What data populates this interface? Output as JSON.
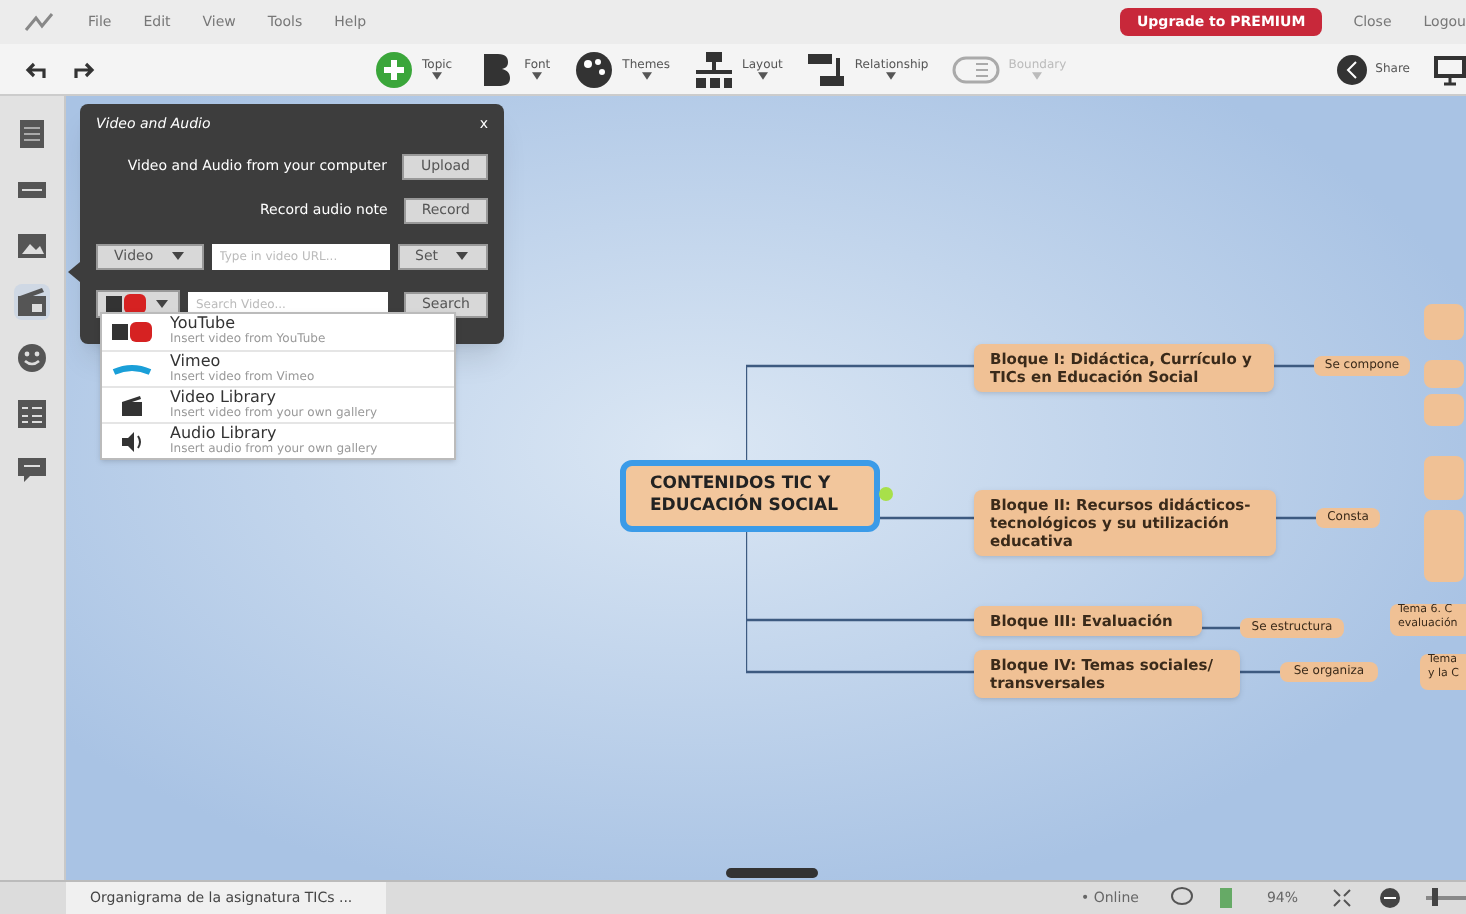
{
  "menu_bar": {
    "items": [
      "File",
      "Edit",
      "View",
      "Tools",
      "Help"
    ],
    "upgrade": "Upgrade to PREMIUM",
    "close": "Close",
    "logout": "Logou"
  },
  "toolbar": {
    "tools": [
      {
        "kind": "topic",
        "label": "Topic",
        "disabled": false
      },
      {
        "kind": "font",
        "label": "Font",
        "disabled": false
      },
      {
        "kind": "themes",
        "label": "Themes",
        "disabled": false
      },
      {
        "kind": "layout",
        "label": "Layout",
        "disabled": false
      },
      {
        "kind": "relationship",
        "label": "Relationship",
        "disabled": false
      },
      {
        "kind": "boundary",
        "label": "Boundary",
        "disabled": true
      }
    ],
    "share": "Share"
  },
  "sidebar": {
    "items": [
      {
        "kind": "note"
      },
      {
        "kind": "link"
      },
      {
        "kind": "image"
      },
      {
        "kind": "video",
        "selected": true
      },
      {
        "kind": "emoji",
        "selected": false
      },
      {
        "kind": "task",
        "selected": false
      },
      {
        "kind": "comment",
        "selected": false
      }
    ]
  },
  "media_panel": {
    "title": "Video and Audio",
    "close": "x",
    "upload_label": "Video and Audio from your computer",
    "upload_button": "Upload",
    "record_label": "Record audio note",
    "record_button": "Record",
    "type_select": "Video",
    "url_placeholder": "Type in video URL...",
    "set_button": "Set",
    "search_placeholder": "Search Video...",
    "search_button": "Search",
    "sources": [
      {
        "kind": "youtube",
        "name": "YouTube",
        "description": "Insert video from YouTube"
      },
      {
        "kind": "vimeo",
        "name": "Vimeo",
        "description": "Insert video from Vimeo"
      },
      {
        "kind": "video",
        "name": "Video Library",
        "description": "Insert video from your own gallery"
      },
      {
        "kind": "audio",
        "name": "Audio Library",
        "description": "Insert audio from your own gallery"
      }
    ]
  },
  "mind_map": {
    "central": "CONTENIDOS TIC Y EDUCACIÓN SOCIAL",
    "branches": [
      {
        "title": "Bloque I: Didáctica, Currículo y TICs en Educación Social",
        "link": "Se compone"
      },
      {
        "title": "Bloque II: Recursos didácticos-tecnológicos y su utilización educativa",
        "link": "Consta"
      },
      {
        "title": "Bloque III: Evaluación",
        "link": "Se estructura",
        "subtopics": [
          [
            "Tema 6. C",
            "evaluación"
          ]
        ]
      },
      {
        "title": "Bloque IV: Temas sociales/ transversales",
        "link": "Se organiza",
        "subtopics": [
          [
            "Tema",
            "y la C"
          ]
        ]
      }
    ]
  },
  "status_bar": {
    "document_tab": "Organigrama de la asignatura TICs ...",
    "status": "• Online",
    "zoom": "94%",
    "zoom_slider": {
      "level": 0.15
    }
  }
}
